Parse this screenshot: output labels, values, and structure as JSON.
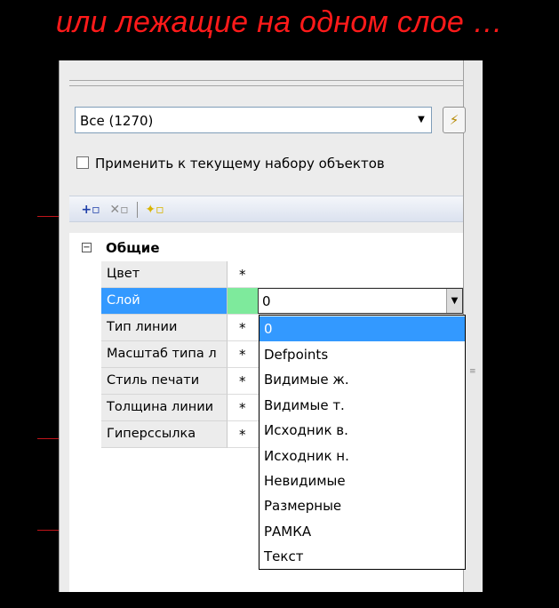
{
  "caption": "или лежащие на одном слое …",
  "combo": {
    "value": "Все (1270)",
    "arrow": "▼"
  },
  "quick_select_glyph": "⚡",
  "apply_checkbox": {
    "label": "Применить к текущему набору объектов",
    "checked": false
  },
  "toolbar": [
    {
      "name": "add-to-selection-icon",
      "glyph": "+▫"
    },
    {
      "name": "remove-from-selection-icon",
      "glyph": "✕▫"
    },
    {
      "name": "quick-select-filter-icon",
      "glyph": "✦▫"
    }
  ],
  "section": {
    "toggle": "−",
    "title": "Общие"
  },
  "properties": [
    {
      "name": "Цвет",
      "value": "*"
    },
    {
      "name": "Слой",
      "value": "0"
    },
    {
      "name": "Тип линии",
      "value": "*"
    },
    {
      "name": "Масштаб типа л",
      "value": "*"
    },
    {
      "name": "Стиль печати",
      "value": "*"
    },
    {
      "name": "Толщина линии",
      "value": "*"
    },
    {
      "name": "Гиперссылка",
      "value": "*"
    }
  ],
  "layer_dropdown": {
    "selected": "0",
    "arrow": "▼",
    "options": [
      "0",
      "Defpoints",
      "Видимые ж.",
      "Видимые т.",
      "Исходник в.",
      "Исходник н.",
      "Невидимые",
      "Размерные",
      "РАМКА",
      "Текст"
    ]
  },
  "colors": {
    "caption": "#ff1a1a",
    "selection": "#3399ff",
    "layer_swatch": "#7eea9c",
    "drawing_line": "#c0141a"
  }
}
